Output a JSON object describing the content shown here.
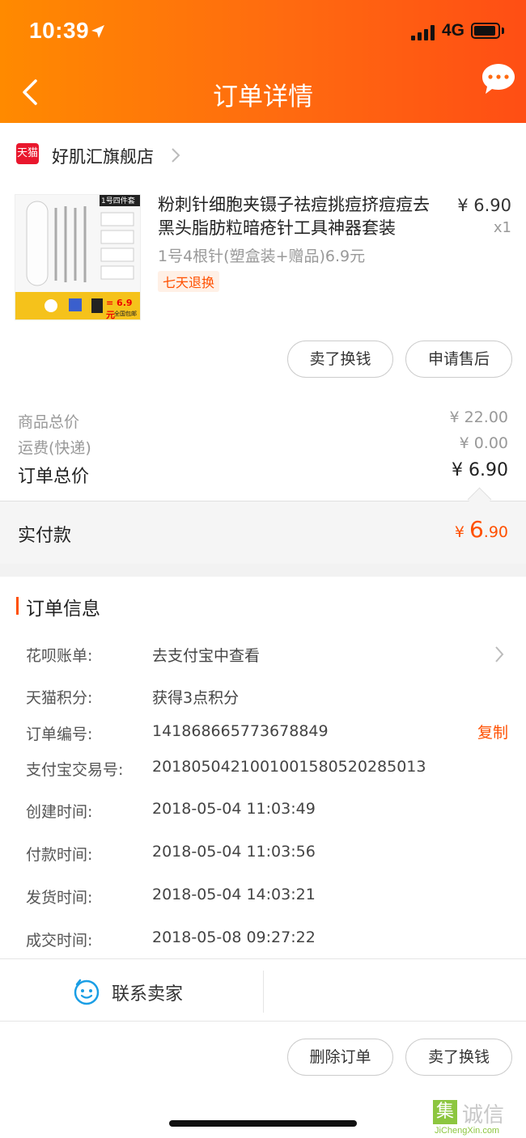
{
  "status_bar": {
    "time": "10:39",
    "network": "4G"
  },
  "header": {
    "title": "订单详情"
  },
  "store": {
    "badge": "天猫",
    "name": "好肌汇旗舰店"
  },
  "product": {
    "title": "粉刺针细胞夹镊子祛痘挑痘挤痘痘去黑头脂肪粒暗疮针工具神器套装",
    "sku": "1号4根针(塑盒装+赠品)6.9元",
    "badge": "七天退换",
    "price": "¥ 6.90",
    "qty": "x1",
    "image": {
      "tag": "1号四件套",
      "promo_price": "= 6.9元",
      "promo_sub": "全国包邮"
    }
  },
  "actions": {
    "sell": "卖了换钱",
    "after_sales": "申请售后"
  },
  "summary": {
    "goods_label": "商品总价",
    "goods_value": "¥ 22.00",
    "shipping_label": "运费(快递)",
    "shipping_value": "¥ 0.00",
    "total_label": "订单总价",
    "total_value": "¥ 6.90",
    "paid_label": "实付款",
    "paid_symbol": "¥ ",
    "paid_int": "6",
    "paid_dec": ".90"
  },
  "order_info": {
    "title": "订单信息",
    "huabei_label": "花呗账单:",
    "huabei_value": "去支付宝中查看",
    "points_label": "天猫积分:",
    "points_value": "获得3点积分",
    "order_no_label": "订单编号:",
    "order_no_value": "141868665773678849",
    "copy": "复制",
    "alipay_label": "支付宝交易号:",
    "alipay_value": "2018050421001001580520285013",
    "created_label": "创建时间:",
    "created_value": "2018-05-04 11:03:49",
    "paid_label": "付款时间:",
    "paid_value": "2018-05-04 11:03:56",
    "shipped_label": "发货时间:",
    "shipped_value": "2018-05-04 14:03:21",
    "completed_label": "成交时间:",
    "completed_value": "2018-05-08 09:27:22"
  },
  "contact": {
    "label": "联系卖家"
  },
  "bottom_actions": {
    "delete": "删除订单",
    "sell": "卖了换钱"
  },
  "watermark": {
    "mark": "集",
    "text": "诚信",
    "url": "JiChengXin.com"
  },
  "colors": {
    "accent": "#ff5000",
    "header_start": "#ff8a00",
    "header_end": "#ff4e14",
    "tmall_red": "#e9172d"
  }
}
